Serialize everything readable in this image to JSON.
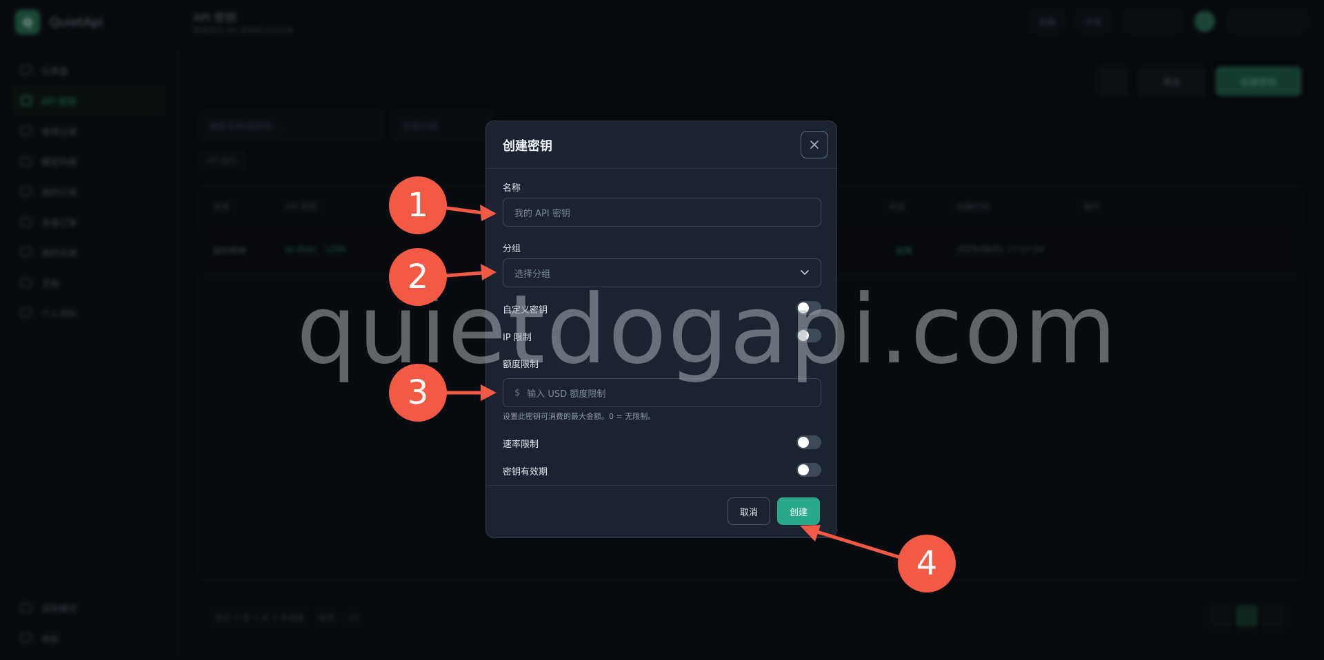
{
  "app": {
    "brand": "QuietApi",
    "nav": [
      "仪表盘",
      "API 密钥",
      "使用记录",
      "模型列表",
      "我的订阅",
      "充值订单",
      "我的兑换",
      "文档",
      "个人资料"
    ],
    "side_bottom": [
      "深色模式",
      "收起"
    ],
    "page_title": "API 密钥",
    "page_subtitle": "管理您的 API 密钥和访问令牌",
    "top_right": [
      "文档",
      "中文"
    ],
    "actions": [
      "导出",
      "创建密钥"
    ],
    "filters": [
      "搜索名称或密钥...",
      "全部分组"
    ],
    "endpoint": "API 端点",
    "table_headers": [
      "名称",
      "API 密钥",
      "状态",
      "创建时间",
      "操作"
    ],
    "row": [
      "我的密钥",
      "sk-bb4c...1294",
      "启用",
      "2025/08/01 17:57:24"
    ],
    "footer_info": "显示 1 至 1 共 1 条结果",
    "footer_per_page": "每页",
    "footer_size": "20"
  },
  "modal": {
    "title": "创建密钥",
    "close_icon": "close-icon",
    "name_label": "名称",
    "name_placeholder": "我的 API 密钥",
    "group_label": "分组",
    "group_placeholder": "选择分组",
    "custom_key_label": "自定义密钥",
    "ip_limit_label": "IP 限制",
    "quota_label": "额度限制",
    "currency_symbol": "$",
    "quota_placeholder": "输入 USD 额度限制",
    "quota_hint": "设置此密钥可消费的最大金额。0 = 无限制。",
    "rate_limit_label": "速率限制",
    "expiry_label": "密钥有效期",
    "cancel_label": "取消",
    "create_label": "创建",
    "toggles": {
      "custom_key": false,
      "ip_limit": false,
      "rate_limit": false,
      "expiry": false
    }
  },
  "annotations": {
    "watermark": "quietdogapi.com",
    "badges": [
      "1",
      "2",
      "3",
      "4"
    ],
    "color": "#f25a45"
  },
  "colors": {
    "accent": "#2aa88a",
    "modal_bg": "#1b2330"
  }
}
